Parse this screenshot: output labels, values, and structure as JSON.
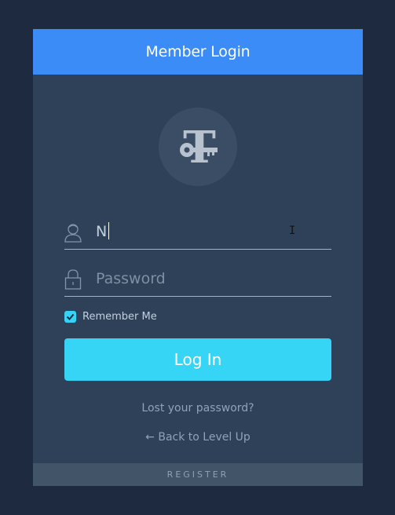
{
  "header": {
    "title": "Member Login"
  },
  "logo": {
    "letter": "T",
    "icon": "key-icon"
  },
  "form": {
    "username": {
      "value": "N",
      "placeholder": "",
      "icon": "user-icon"
    },
    "password": {
      "value": "",
      "placeholder": "Password",
      "icon": "lock-icon"
    },
    "remember": {
      "label": "Remember Me",
      "checked": true
    },
    "submit_label": "Log In"
  },
  "links": {
    "lost_password": "Lost your password?",
    "back": "← Back to Level Up"
  },
  "footer": {
    "register_label": "REGISTER"
  },
  "colors": {
    "background": "#1d2a40",
    "card": "#2f4159",
    "header": "#3b8cf6",
    "accent": "#36d4f5"
  }
}
